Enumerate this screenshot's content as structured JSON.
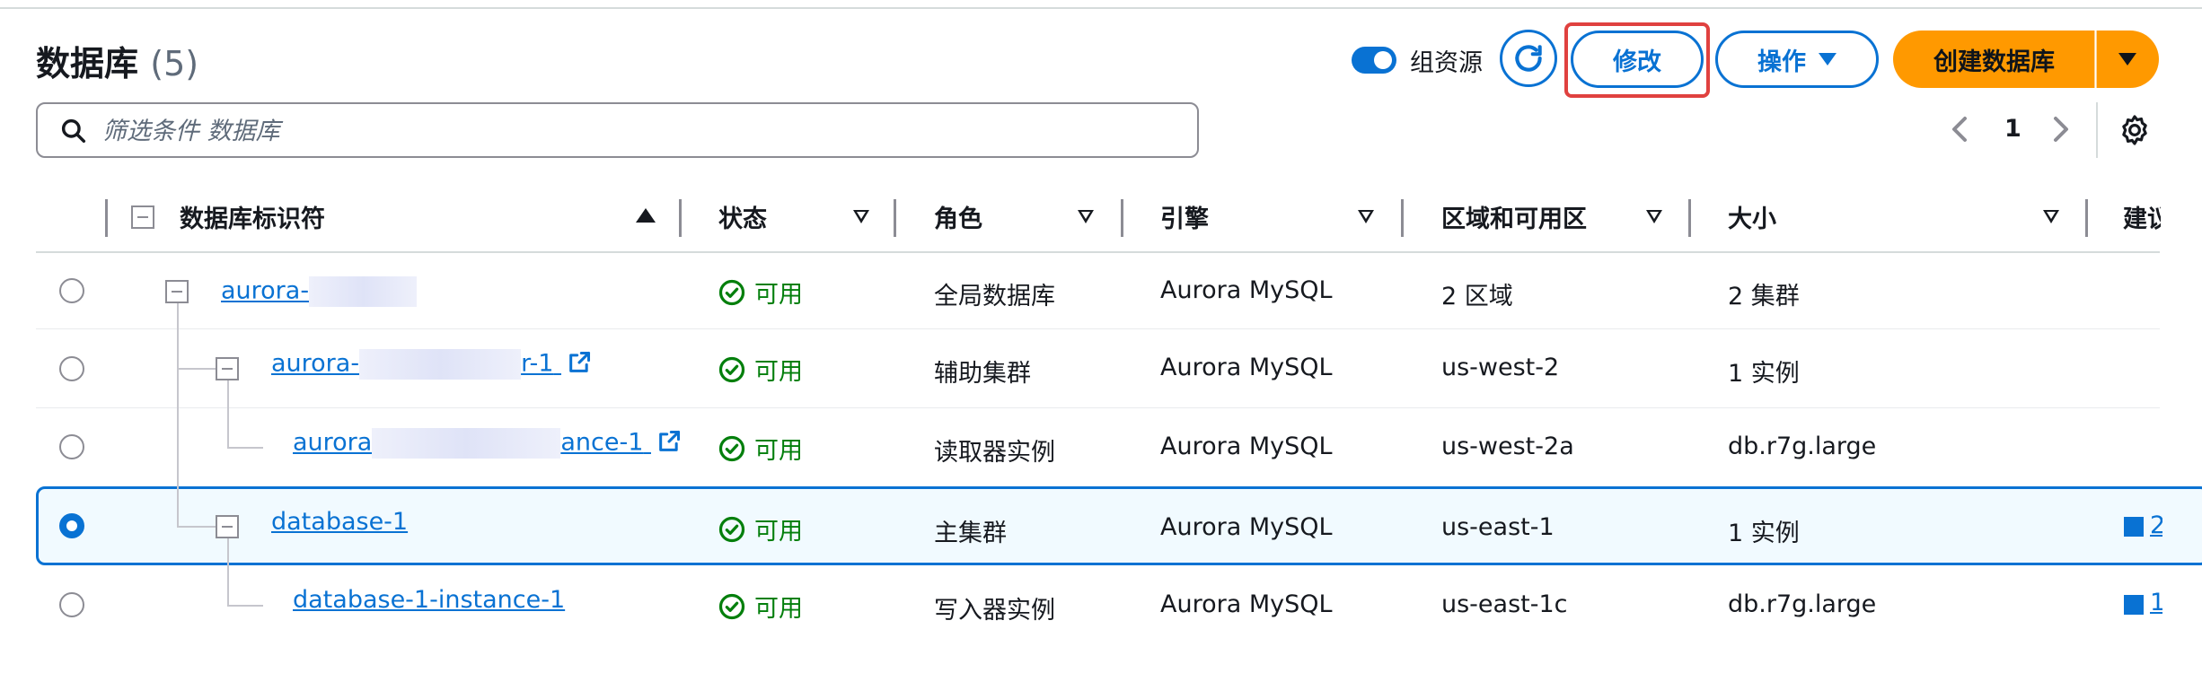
{
  "header": {
    "title": "数据库",
    "count": "(5)"
  },
  "toolbar": {
    "group_toggle_label": "组资源",
    "modify_label": "修改",
    "actions_label": "操作",
    "create_label": "创建数据库"
  },
  "search": {
    "placeholder": "筛选条件 数据库"
  },
  "pagination": {
    "current": "1"
  },
  "columns": {
    "identifier": "数据库标识符",
    "status": "状态",
    "role": "角色",
    "engine": "引擎",
    "region": "区域和可用区",
    "size": "大小",
    "recommend": "建议"
  },
  "rows": [
    {
      "id_prefix": "aurora-",
      "id_suffix": "",
      "status": "可用",
      "role": "全局数据库",
      "engine": "Aurora MySQL",
      "region": "2 区域",
      "size": "2 集群"
    },
    {
      "id_prefix": "aurora-",
      "id_suffix": "r-1",
      "status": "可用",
      "role": "辅助集群",
      "engine": "Aurora MySQL",
      "region": "us-west-2",
      "size": "1 实例"
    },
    {
      "id_prefix": "aurora",
      "id_suffix": "ance-1",
      "status": "可用",
      "role": "读取器实例",
      "engine": "Aurora MySQL",
      "region": "us-west-2a",
      "size": "db.r7g.large"
    },
    {
      "id": "database-1",
      "status": "可用",
      "role": "主集群",
      "engine": "Aurora MySQL",
      "region": "us-east-1",
      "size": "1 实例",
      "recommend": "2"
    },
    {
      "id": "database-1-instance-1",
      "status": "可用",
      "role": "写入器实例",
      "engine": "Aurora MySQL",
      "region": "us-east-1c",
      "size": "db.r7g.large",
      "recommend": "1"
    }
  ],
  "colors": {
    "accent": "#0972d3",
    "primary": "#ff9900",
    "success": "#037f0c",
    "highlight": "#e0413f"
  }
}
